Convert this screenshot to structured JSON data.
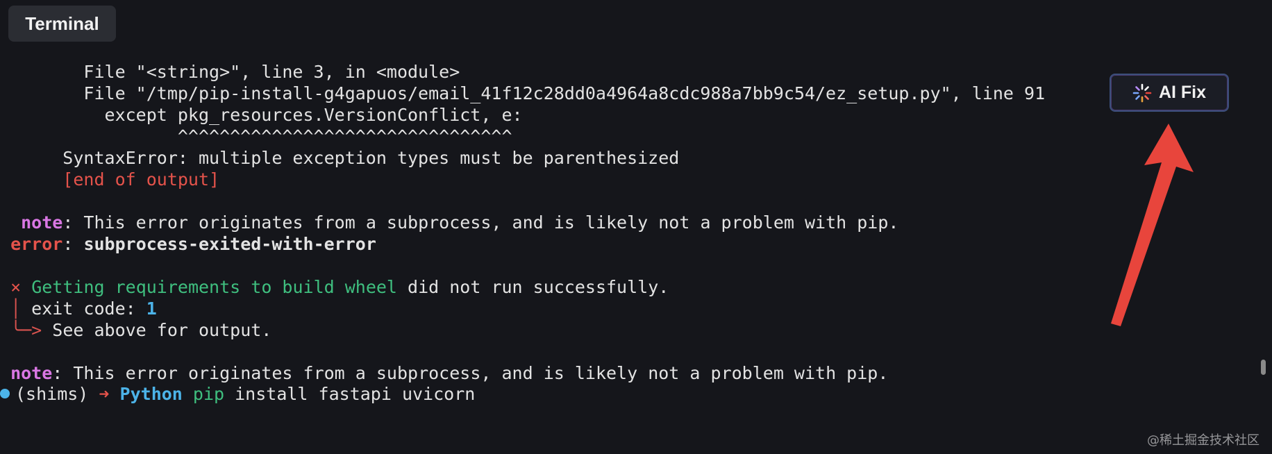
{
  "tab": {
    "label": "Terminal"
  },
  "ai_fix": {
    "label": "AI Fix"
  },
  "terminal": {
    "lines": {
      "l1": "        File \"<string>\", line 3, in <module>",
      "l2": "        File \"/tmp/pip-install-g4gapuos/email_41f12c28dd0a4964a8cdc988a7bb9c54/ez_setup.py\", line 91",
      "l3": "          except pkg_resources.VersionConflict, e:",
      "l4": "                 ^^^^^^^^^^^^^^^^^^^^^^^^^^^^^^^^",
      "l5": "      SyntaxError: multiple exception types must be parenthesized",
      "l6": "      [end of output]",
      "l7_label": "note",
      "l7_text": ": This error originates from a subprocess, and is likely not a problem with pip.",
      "l8_label": "error",
      "l8_sep": ": ",
      "l8_text": "subprocess-exited-with-error",
      "l9_mark": "×",
      "l9_green": "Getting requirements to build wheel",
      "l9_rest": " did not run successfully.",
      "l10_bar": "│",
      "l10_text": " exit code: ",
      "l10_code": "1",
      "l11_arrow": "╰─>",
      "l11_text": " See above for output.",
      "l12_label": "note",
      "l12_text": ": This error originates from a subprocess, and is likely not a problem with pip.",
      "l13_env": "(shims)",
      "l13_arrow": "➜",
      "l13_dir": "Python",
      "l13_cmd1": "pip",
      "l13_cmd2": " install fastapi uvicorn"
    }
  },
  "watermark": "@稀土掘金技术社区",
  "colors": {
    "background": "#15161b",
    "error_red": "#e5534b",
    "note_magenta": "#d977e3",
    "success_green": "#3fbf7f",
    "accent_cyan": "#4cb3e8",
    "arrow_red": "#e8453c"
  }
}
